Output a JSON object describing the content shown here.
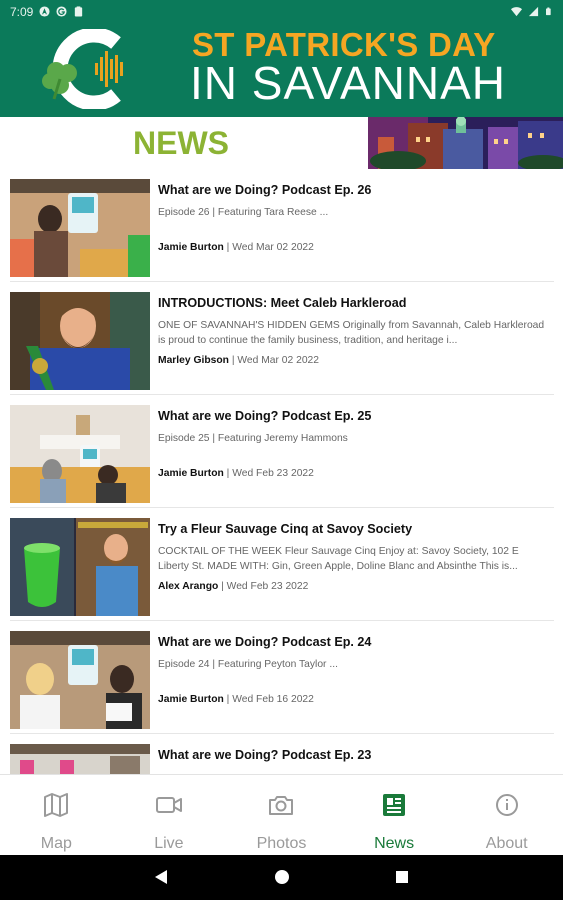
{
  "status_bar": {
    "time": "7:09",
    "icons_left": [
      "a-icon",
      "g-icon",
      "clipboard-icon"
    ],
    "icons_right": [
      "wifi-icon",
      "signal-icon",
      "battery-icon"
    ]
  },
  "header": {
    "title_line1": "ST PATRICK'S DAY",
    "title_line2": "IN SAVANNAH",
    "colors": {
      "header_bg": "#0b7a5a",
      "title_orange": "#f5a623"
    }
  },
  "section": {
    "title": "NEWS",
    "title_color": "#8cb334"
  },
  "news": [
    {
      "title": "What are we Doing? Podcast Ep. 26",
      "excerpt": "Episode 26 | Featuring Tara Reese ...",
      "author": "Jamie Burton",
      "date": " | Wed Mar 02 2022"
    },
    {
      "title": "INTRODUCTIONS: Meet Caleb Harkleroad",
      "excerpt": "ONE OF SAVANNAH'S HIDDEN GEMS  Originally from Savannah, Caleb Harkleroad is proud to continue the family business, tradition, and heritage i...",
      "author": "Marley Gibson",
      "date": " | Wed Mar 02 2022"
    },
    {
      "title": "What are we Doing? Podcast Ep. 25",
      "excerpt": "Episode 25 | Featuring Jeremy Hammons",
      "author": "Jamie Burton",
      "date": " | Wed Feb 23 2022"
    },
    {
      "title": "Try a Fleur Sauvage Cinq at Savoy Society",
      "excerpt": "COCKTAIL OF THE WEEK  Fleur Sauvage Cinq  Enjoy at: Savoy Society, 102 E Liberty St. MADE WITH:  Gin, Green Apple, Doline Blanc and Absinthe  This is...",
      "author": "Alex Arango",
      "date": " | Wed Feb 23 2022"
    },
    {
      "title": "What are we Doing? Podcast Ep. 24",
      "excerpt": "Episode 24 | Featuring Peyton Taylor ...",
      "author": "Jamie Burton",
      "date": " | Wed Feb 16 2022"
    },
    {
      "title": "What are we Doing? Podcast Ep. 23",
      "excerpt": "",
      "author": "",
      "date": ""
    }
  ],
  "bottom_nav": {
    "items": [
      {
        "label": "Map",
        "icon": "map-icon"
      },
      {
        "label": "Live",
        "icon": "video-camera-icon"
      },
      {
        "label": "Photos",
        "icon": "camera-icon"
      },
      {
        "label": "News",
        "icon": "newspaper-icon",
        "active": true
      },
      {
        "label": "About",
        "icon": "info-icon"
      }
    ],
    "active_color": "#1a7a3a",
    "inactive_color": "#9a9a9a"
  },
  "system_nav": [
    "back-icon",
    "home-icon",
    "recents-icon"
  ]
}
